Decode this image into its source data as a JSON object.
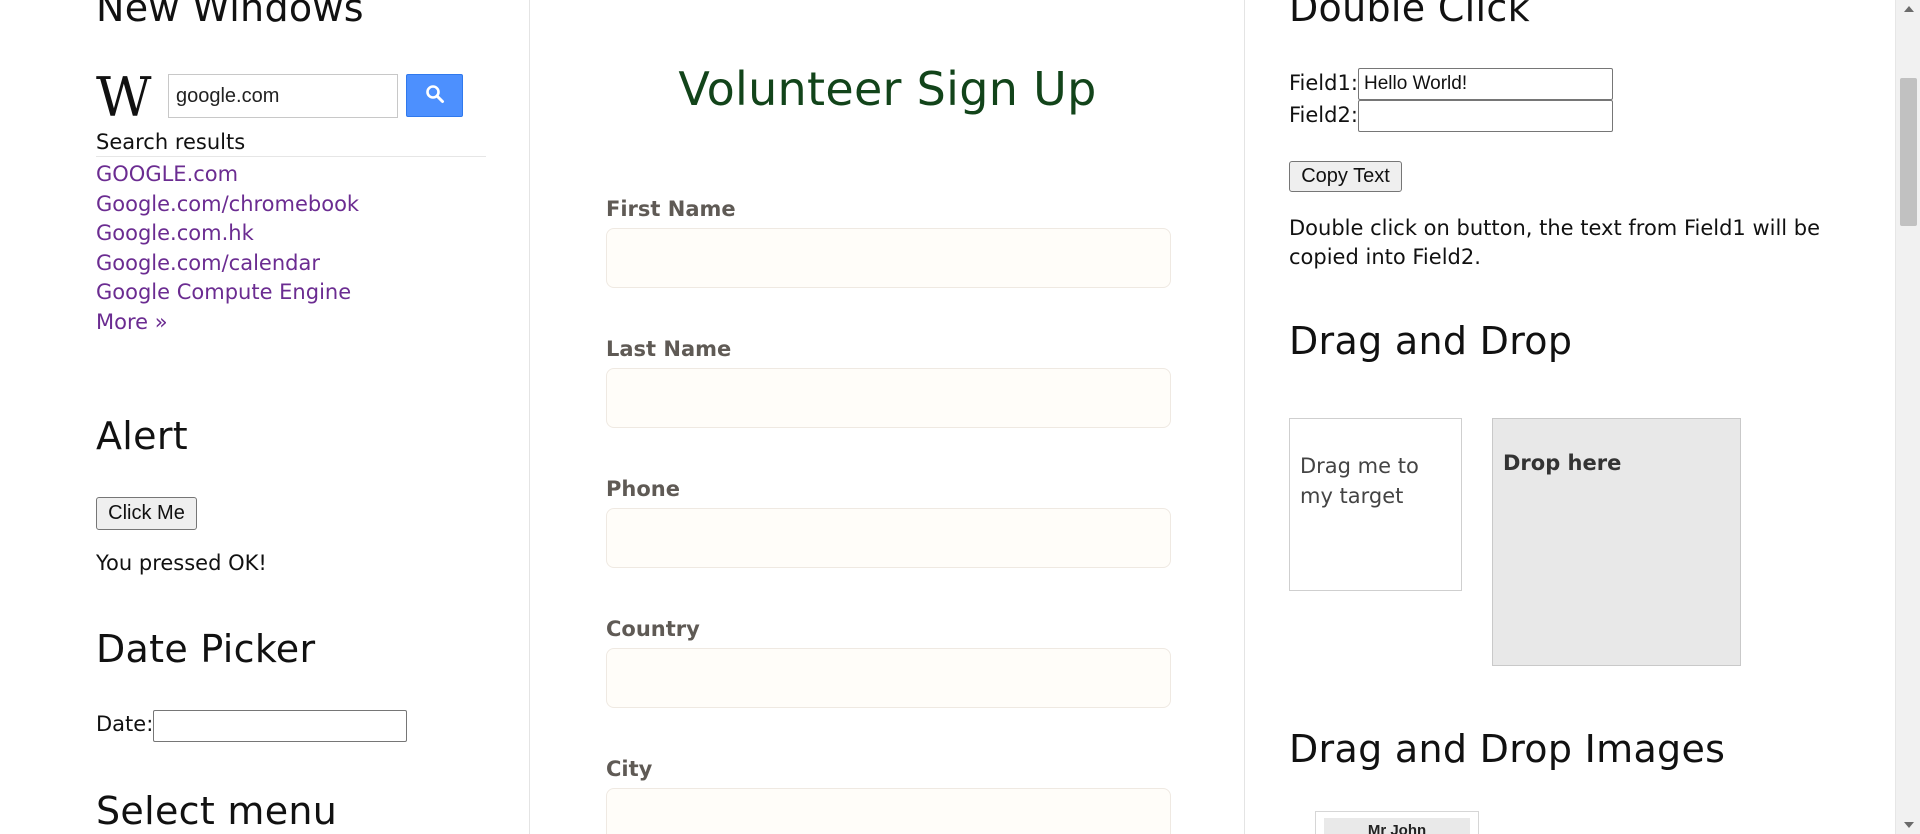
{
  "left": {
    "new_windows_heading": "New Windows",
    "wiki": {
      "logo": "W",
      "search_value": "google.com",
      "search_icon": "magnifier-icon",
      "results_title": "Search results",
      "results": [
        "GOOGLE.com",
        "Google.com/chromebook",
        "Google.com.hk",
        "Google.com/calendar",
        "Google Compute Engine",
        "More »"
      ]
    },
    "alert": {
      "heading": "Alert",
      "button": "Click Me",
      "message": "You pressed OK!"
    },
    "date_picker": {
      "heading": "Date Picker",
      "label": "Date:",
      "value": ""
    },
    "select_menu_heading": "Select menu"
  },
  "middle": {
    "title": "Volunteer Sign Up",
    "fields": [
      {
        "label": "First Name",
        "value": ""
      },
      {
        "label": "Last Name",
        "value": ""
      },
      {
        "label": "Phone",
        "value": ""
      },
      {
        "label": "Country",
        "value": ""
      },
      {
        "label": "City",
        "value": ""
      }
    ]
  },
  "right": {
    "double_click": {
      "heading": "Double Click",
      "field1_label": "Field1:",
      "field1_value": "Hello World!",
      "field2_label": "Field2:",
      "field2_value": "",
      "button": "Copy Text",
      "description_line1": "Double click on button, the text from Field1 will be",
      "description_line2": "copied into Field2."
    },
    "drag_drop": {
      "heading": "Drag and Drop",
      "drag_text": "Drag me to my target",
      "drop_text": "Drop here"
    },
    "drag_drop_images": {
      "heading": "Drag and Drop Images",
      "first_card_title": "Mr John"
    }
  },
  "colors": {
    "link": "#6b2c91",
    "form_title": "#12441a",
    "search_button": "#4d90fe",
    "drop_area": "#e8e8e8"
  }
}
